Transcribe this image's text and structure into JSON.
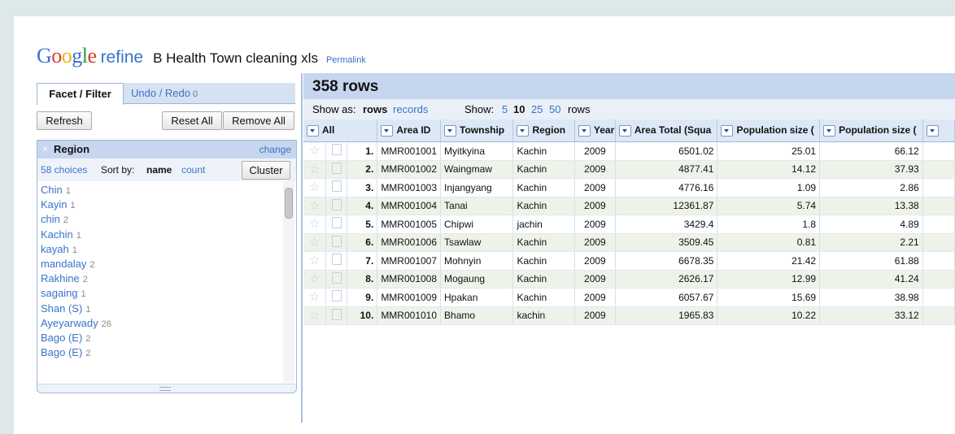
{
  "app": {
    "logo_google_letters": [
      {
        "ch": "G",
        "color": "#3a6fd8"
      },
      {
        "ch": "o",
        "color": "#d93b2b"
      },
      {
        "ch": "o",
        "color": "#f0b400"
      },
      {
        "ch": "g",
        "color": "#3a6fd8"
      },
      {
        "ch": "l",
        "color": "#2e9e45"
      },
      {
        "ch": "e",
        "color": "#d93b2b"
      }
    ],
    "logo_refine": "refine",
    "project_title": "B Health Town cleaning xls",
    "permalink": "Permalink"
  },
  "left": {
    "tabs": {
      "facet": "Facet / Filter",
      "undo": "Undo / Redo",
      "undo_count": "0"
    },
    "buttons": {
      "refresh": "Refresh",
      "reset_all": "Reset All",
      "remove_all": "Remove All"
    },
    "facet": {
      "close": "×",
      "title": "Region",
      "change": "change",
      "choices_label": "58 choices",
      "sort_by": "Sort by:",
      "sort_name": "name",
      "sort_count": "count",
      "cluster": "Cluster",
      "choices": [
        {
          "name": "Chin",
          "count": "1"
        },
        {
          "name": "Kayin",
          "count": "1"
        },
        {
          "name": "chin",
          "count": "2"
        },
        {
          "name": "Kachin",
          "count": "1"
        },
        {
          "name": "kayah",
          "count": "1"
        },
        {
          "name": "mandalay",
          "count": "2"
        },
        {
          "name": "Rakhine",
          "count": "2"
        },
        {
          "name": "sagaing",
          "count": "1"
        },
        {
          "name": "Shan (S)",
          "count": "1"
        },
        {
          "name": "Ayeyarwady",
          "count": "26"
        },
        {
          "name": "Bago (E)",
          "count": "2"
        },
        {
          "name": "Bago (E)",
          "count": "2"
        }
      ]
    }
  },
  "right": {
    "rows_count": "358 rows",
    "show_as_label": "Show as:",
    "show_as_rows": "rows",
    "show_as_records": "records",
    "show_label": "Show:",
    "page_sizes": [
      "5",
      "10",
      "25",
      "50"
    ],
    "rows_word": "rows",
    "columns": [
      "All",
      "Area ID",
      "Township",
      "Region",
      "Year",
      "Area Total (Squa",
      "Population size (",
      "Population size ("
    ],
    "rows": [
      {
        "ix": "1.",
        "id": "MMR001001",
        "township": "Myitkyina",
        "region": "Kachin",
        "year": "2009",
        "area": "6501.02",
        "pop1": "25.01",
        "pop2": "66.12"
      },
      {
        "ix": "2.",
        "id": "MMR001002",
        "township": "Waingmaw",
        "region": "Kachin",
        "year": "2009",
        "area": "4877.41",
        "pop1": "14.12",
        "pop2": "37.93"
      },
      {
        "ix": "3.",
        "id": "MMR001003",
        "township": "Injangyang",
        "region": "Kachin",
        "year": "2009",
        "area": "4776.16",
        "pop1": "1.09",
        "pop2": "2.86"
      },
      {
        "ix": "4.",
        "id": "MMR001004",
        "township": "Tanai",
        "region": "Kachin",
        "year": "2009",
        "area": "12361.87",
        "pop1": "5.74",
        "pop2": "13.38"
      },
      {
        "ix": "5.",
        "id": "MMR001005",
        "township": "Chipwi",
        "region": "jachin",
        "year": "2009",
        "area": "3429.4",
        "pop1": "1.8",
        "pop2": "4.89"
      },
      {
        "ix": "6.",
        "id": "MMR001006",
        "township": "Tsawlaw",
        "region": "Kachin",
        "year": "2009",
        "area": "3509.45",
        "pop1": "0.81",
        "pop2": "2.21"
      },
      {
        "ix": "7.",
        "id": "MMR001007",
        "township": "Mohnyin",
        "region": "Kachin",
        "year": "2009",
        "area": "6678.35",
        "pop1": "21.42",
        "pop2": "61.88"
      },
      {
        "ix": "8.",
        "id": "MMR001008",
        "township": "Mogaung",
        "region": "Kachin",
        "year": "2009",
        "area": "2626.17",
        "pop1": "12.99",
        "pop2": "41.24"
      },
      {
        "ix": "9.",
        "id": "MMR001009",
        "township": "Hpakan",
        "region": "Kachin",
        "year": "2009",
        "area": "6057.67",
        "pop1": "15.69",
        "pop2": "38.98"
      },
      {
        "ix": "10.",
        "id": "MMR001010",
        "township": "Bhamo",
        "region": "kachin",
        "year": "2009",
        "area": "1965.83",
        "pop1": "10.22",
        "pop2": "33.12"
      }
    ]
  }
}
